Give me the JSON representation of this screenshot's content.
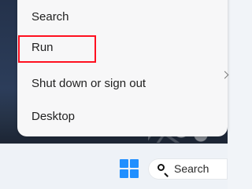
{
  "context_menu": {
    "items": [
      {
        "label": "Search"
      },
      {
        "label": "Run"
      },
      {
        "label": "Shut down or sign out",
        "has_submenu": true,
        "submenu_icon": "chevron-right-icon"
      },
      {
        "label": "Desktop"
      }
    ],
    "highlighted_item": "Run",
    "highlight_color": "#ff1020"
  },
  "taskbar": {
    "start_icon": "windows-start-icon",
    "start_color": "#1f8fff",
    "search_icon": "search-icon",
    "search_label": "Search"
  },
  "desktop": {
    "background": "dark-blue-wallpaper"
  }
}
